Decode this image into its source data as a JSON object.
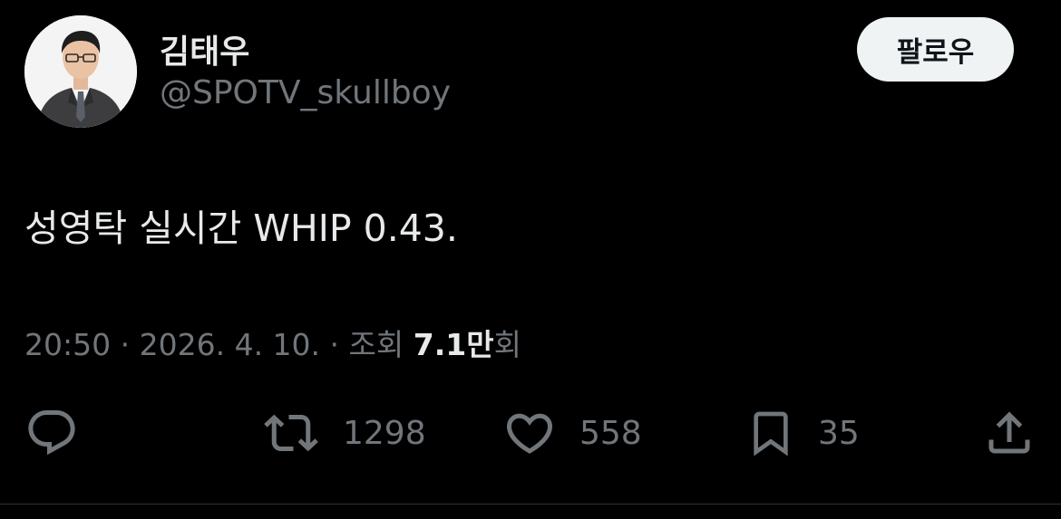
{
  "author": {
    "display_name": "김태우",
    "handle": "@SPOTV_skullboy",
    "avatar_icon": "profile-photo"
  },
  "follow_button": {
    "label": "팔로우"
  },
  "tweet": {
    "text": "성영탁 실시간 WHIP 0.43.",
    "time": "20:50",
    "date": "2026. 4. 10.",
    "separator": "·",
    "views_label": "조회",
    "views_count": "7.1만",
    "views_suffix": "회"
  },
  "actions": {
    "reply": {
      "icon": "reply-icon"
    },
    "retweet": {
      "icon": "retweet-icon",
      "count": "1298"
    },
    "like": {
      "icon": "heart-icon",
      "count": "558"
    },
    "bookmark": {
      "icon": "bookmark-icon",
      "count": "35"
    },
    "share": {
      "icon": "share-icon"
    }
  },
  "colors": {
    "background": "#000000",
    "text_primary": "#e7e9ea",
    "text_secondary": "#71767b",
    "button_bg": "#eff3f4",
    "divider": "#2f3336"
  }
}
